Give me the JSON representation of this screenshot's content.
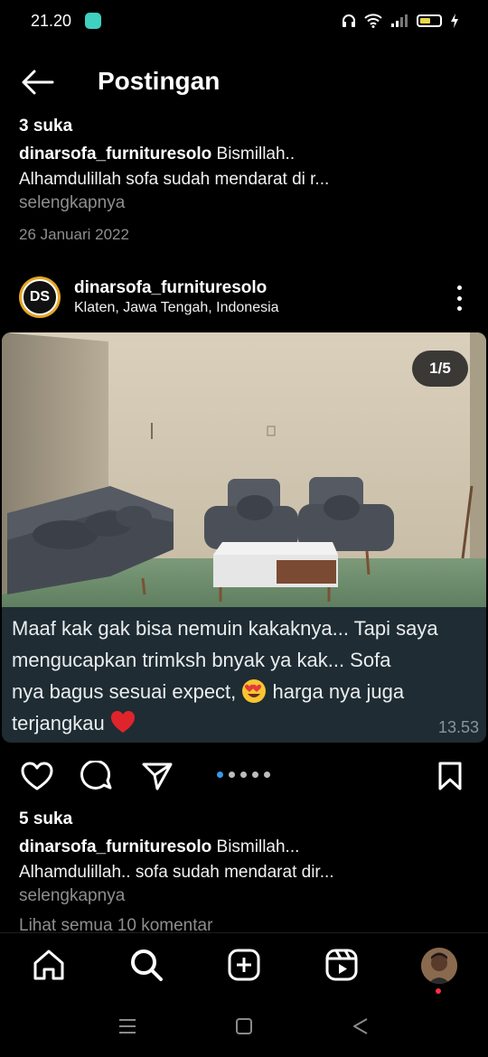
{
  "status": {
    "time": "21.20"
  },
  "header": {
    "title": "Postingan"
  },
  "prev_post": {
    "likes": "3 suka",
    "username": "dinarsofa_furnituresolo",
    "caption_start": " Bismillah..",
    "caption_line2": "Alhamdulillah sofa sudah mendarat di r...",
    "more": "selengkapnya",
    "date": "26 Januari 2022"
  },
  "post": {
    "avatar_text": "DS",
    "username": "dinarsofa_furnituresolo",
    "location": "Klaten, Jawa Tengah, Indonesia",
    "counter": "1/5",
    "chat_line1": "Maaf kak gak bisa nemuin kakaknya... Tapi saya",
    "chat_line2": "mengucapkan  trimksh bnyak ya kak... Sofa",
    "chat_line3a": "nya bagus sesuai expect, ",
    "chat_line3b": "  harga nya juga",
    "chat_line4": "terjangkau ",
    "chat_time": "13.53",
    "likes": "5 suka",
    "caption_start": " Bismillah...",
    "caption_line2": "Alhamdulillah.. sofa sudah mendarat dir...",
    "more": "selengkapnya",
    "comments": "Lihat semua 10 komentar"
  },
  "icons": {
    "back": "arrow-left-icon",
    "like": "heart-icon",
    "comment": "comment-icon",
    "share": "send-icon",
    "save": "bookmark-icon",
    "home": "home-icon",
    "search": "search-icon",
    "create": "plus-square-icon",
    "reels": "reels-icon"
  },
  "colors": {
    "background": "#000000",
    "chat_bubble": "#1f2c33",
    "muted_text": "#8e8e8e",
    "active_dot": "#3897f0",
    "notification_dot": "#ff3040"
  }
}
